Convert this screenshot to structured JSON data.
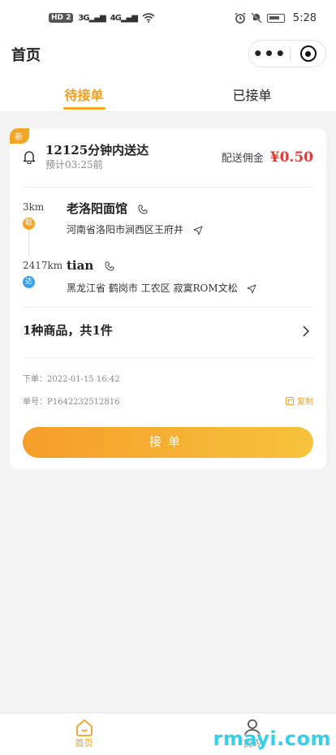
{
  "status_bar": {
    "hd_label": "HD 2",
    "signal1": "3G",
    "signal2": "4G",
    "time": "5:28"
  },
  "title_bar": {
    "title": "首页",
    "more_label": "•••"
  },
  "tabs": [
    {
      "label": "待接单",
      "active": true
    },
    {
      "label": "已接单",
      "active": false
    }
  ],
  "order": {
    "badge": "新",
    "title": "12125分钟内送达",
    "estimate": "预计03:25前",
    "commission_label": "配送佣金",
    "commission_value": "¥0.50",
    "pickup": {
      "distance": "3km",
      "pin": "取",
      "name": "老洛阳面馆",
      "address": "河南省洛阳市涧西区王府井"
    },
    "dropoff": {
      "distance": "2417km",
      "pin": "达",
      "name": "tian",
      "address": "黑龙江省 鹤岗市 工农区 寂寞ROM文松"
    },
    "goods": "1种商品，共1件",
    "order_time": "下单：2022-01-15 16:42",
    "order_no": "单号：P1642232512816",
    "copy_label": "复制",
    "accept_label": "接单"
  },
  "tabbar": [
    {
      "label": "首页",
      "active": true
    },
    {
      "label": "我的",
      "active": false
    }
  ],
  "watermark": "rmayi.com",
  "colors": {
    "accent": "#f5a524",
    "price": "#e53935",
    "drop_pin": "#3ca0e8"
  }
}
